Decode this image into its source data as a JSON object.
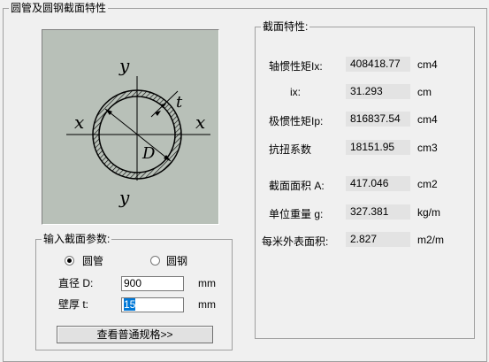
{
  "window": {
    "title": "圆管及圆钢截面特性"
  },
  "diagram": {
    "labels": {
      "y_top": "y",
      "y_bottom": "y",
      "x_left": "x",
      "x_right": "x",
      "thickness": "t",
      "diameter": "D"
    }
  },
  "input_group": {
    "title": "输入截面参数:",
    "radio_options": [
      {
        "label": "圆管",
        "selected": true
      },
      {
        "label": "圆钢",
        "selected": false
      }
    ],
    "diameter": {
      "label": "直径 D:",
      "value": "900",
      "unit": "mm"
    },
    "thickness": {
      "label": "壁厚 t:",
      "value": "15",
      "unit": "mm"
    },
    "button_label": "查看普通规格>>"
  },
  "properties_group": {
    "title": "截面特性:",
    "rows": [
      {
        "label": "轴惯性矩Ix:",
        "value": "408418.77",
        "unit": "cm4"
      },
      {
        "label": "ix:",
        "value": "31.293",
        "unit": "cm"
      },
      {
        "label": "极惯性矩Ip:",
        "value": "816837.54",
        "unit": "cm4"
      },
      {
        "label": "抗扭系数",
        "value": "18151.95",
        "unit": "cm3"
      },
      {
        "label": "截面面积 A:",
        "value": "417.046",
        "unit": "cm2"
      },
      {
        "label": "单位重量 g:",
        "value": "327.381",
        "unit": "kg/m"
      },
      {
        "label": "每米外表面积:",
        "value": "2.827",
        "unit": "m2/m"
      }
    ]
  }
}
